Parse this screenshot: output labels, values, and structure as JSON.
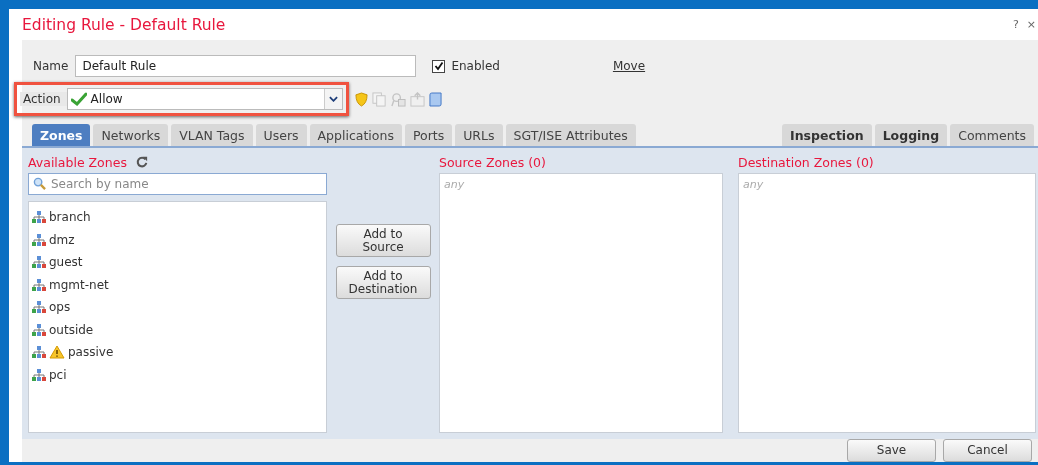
{
  "window": {
    "title": "Editing Rule - Default Rule",
    "help": "?",
    "close": "×"
  },
  "form": {
    "name_label": "Name",
    "name_value": "Default Rule",
    "enabled_label": "Enabled",
    "enabled": true,
    "move_link": "Move",
    "action_label": "Action",
    "action_value": "Allow",
    "action_highlighted": true
  },
  "tabs_left": [
    {
      "label": "Zones",
      "selected": true
    },
    {
      "label": "Networks",
      "selected": false
    },
    {
      "label": "VLAN Tags",
      "selected": false
    },
    {
      "label": "Users",
      "selected": false
    },
    {
      "label": "Applications",
      "selected": false
    },
    {
      "label": "Ports",
      "selected": false
    },
    {
      "label": "URLs",
      "selected": false
    },
    {
      "label": "SGT/ISE Attributes",
      "selected": false
    }
  ],
  "tabs_right": [
    {
      "label": "Inspection",
      "selected": false,
      "emphasized": true
    },
    {
      "label": "Logging",
      "selected": false,
      "emphasized": true
    },
    {
      "label": "Comments",
      "selected": false,
      "emphasized": false
    }
  ],
  "available_zones": {
    "title": "Available Zones",
    "search_placeholder": "Search by name",
    "items": [
      {
        "name": "branch",
        "warning": false
      },
      {
        "name": "dmz",
        "warning": false
      },
      {
        "name": "guest",
        "warning": false
      },
      {
        "name": "mgmt-net",
        "warning": false
      },
      {
        "name": "ops",
        "warning": false
      },
      {
        "name": "outside",
        "warning": false
      },
      {
        "name": "passive",
        "warning": true
      },
      {
        "name": "pci",
        "warning": false
      }
    ]
  },
  "add_buttons": [
    {
      "line1": "Add to",
      "line2": "Source"
    },
    {
      "line1": "Add to",
      "line2": "Destination"
    }
  ],
  "source_zones": {
    "title": "Source Zones (0)",
    "placeholder": "any"
  },
  "destination_zones": {
    "title": "Destination Zones (0)",
    "placeholder": "any"
  },
  "buttons": [
    "Save",
    "Cancel"
  ]
}
